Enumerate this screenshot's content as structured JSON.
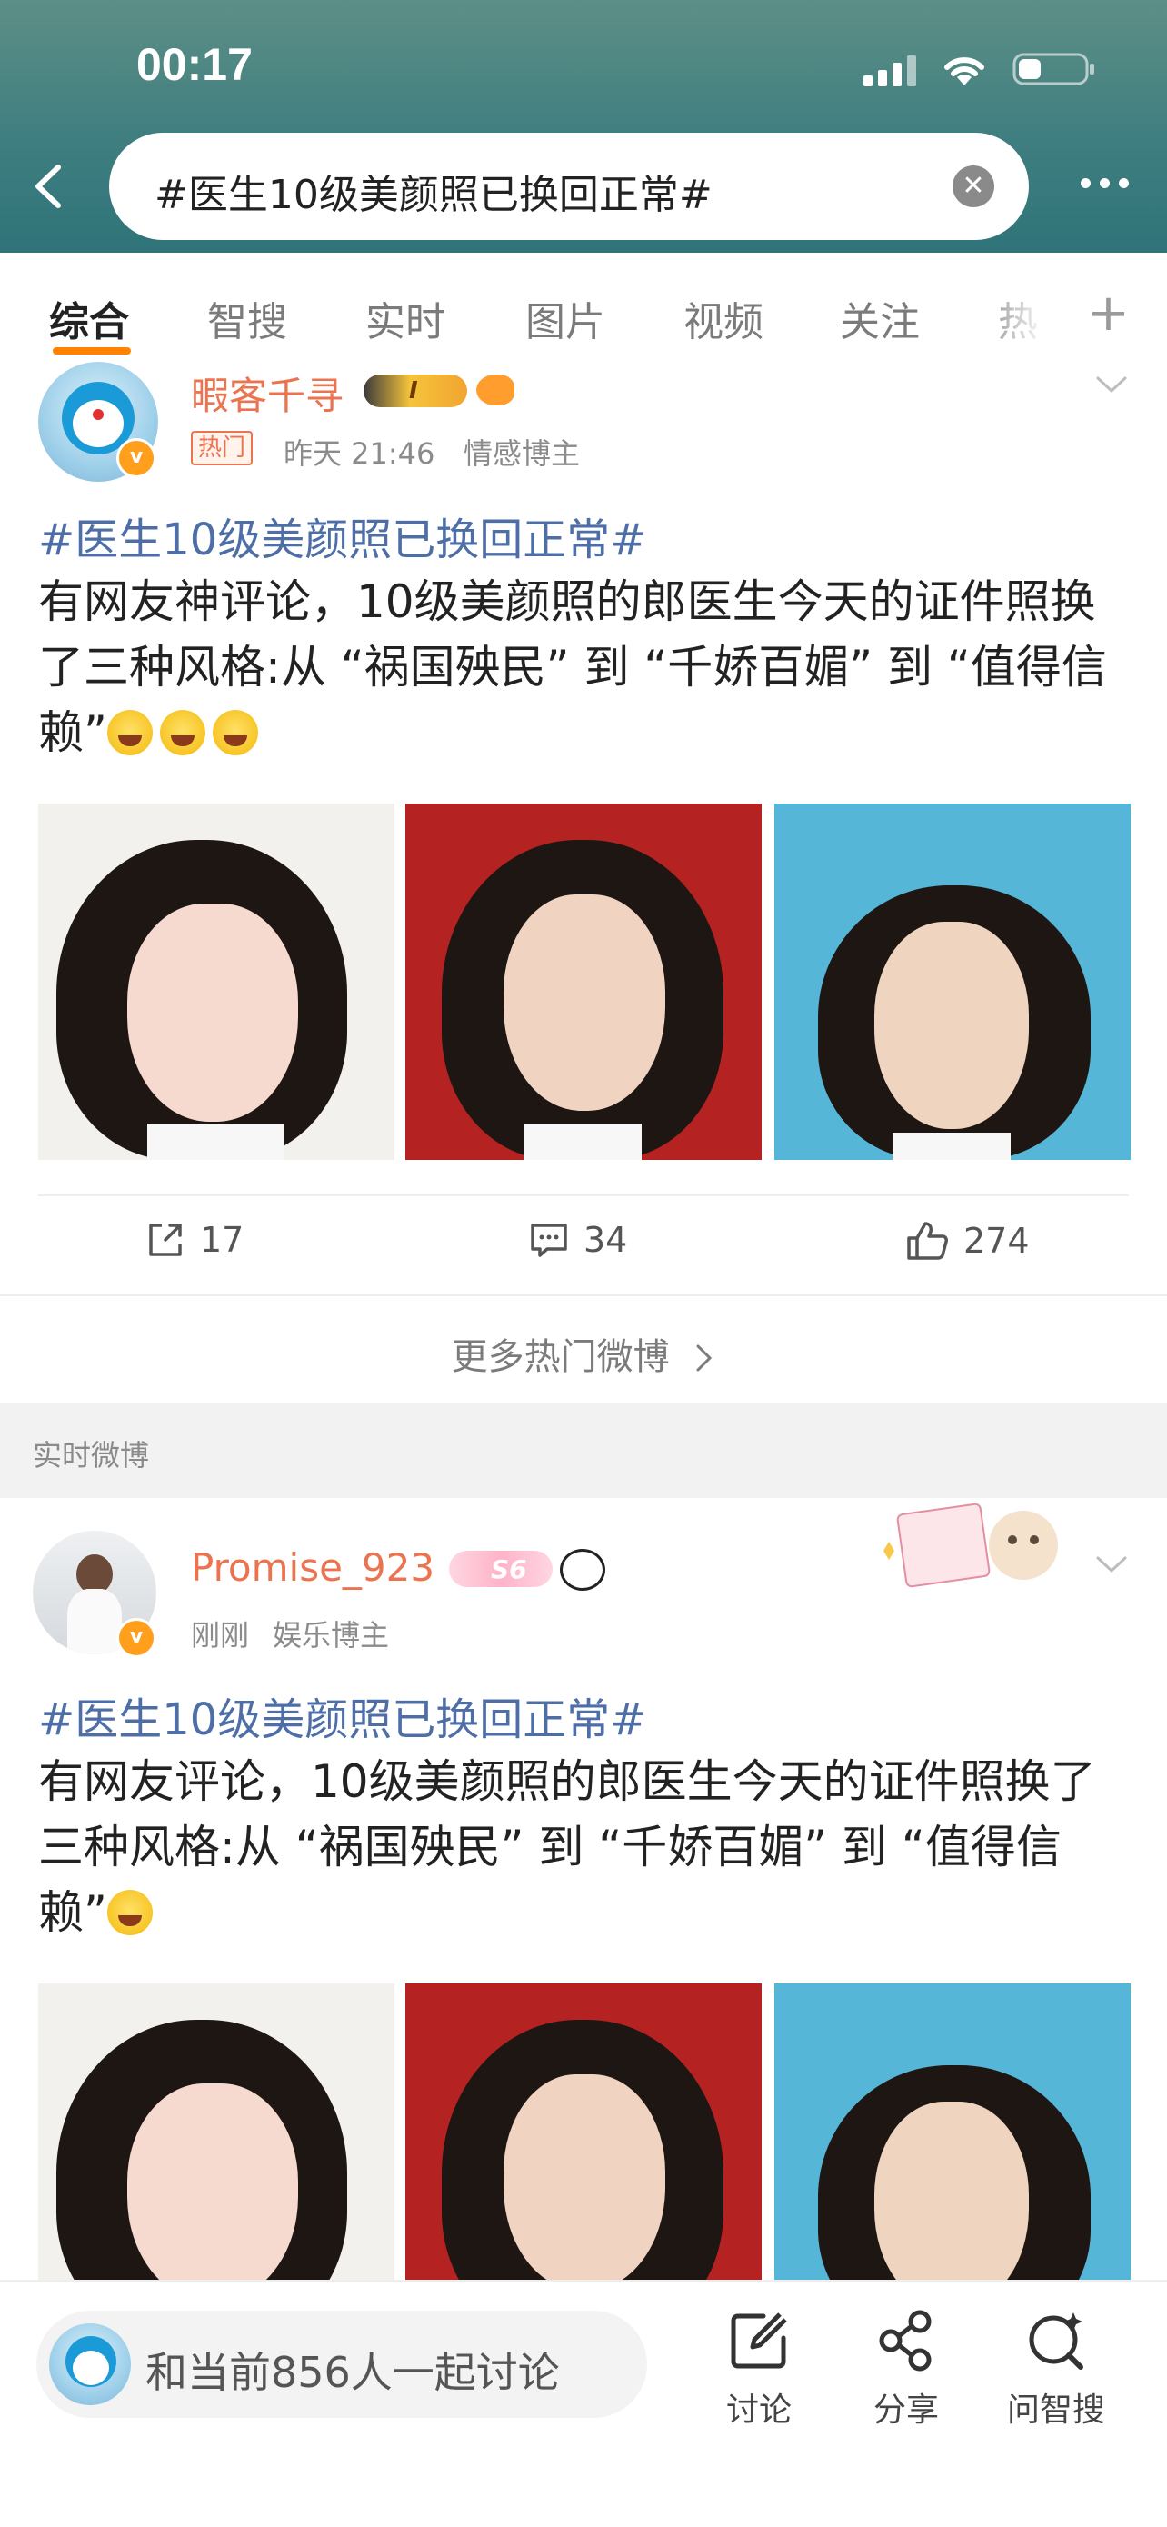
{
  "status_bar": {
    "time": "00:17"
  },
  "search": {
    "query": "#医生10级美颜照已换回正常#"
  },
  "tabs": [
    {
      "label": "综合",
      "active": true
    },
    {
      "label": "智搜"
    },
    {
      "label": "实时"
    },
    {
      "label": "图片"
    },
    {
      "label": "视频"
    },
    {
      "label": "关注"
    },
    {
      "label": "热"
    }
  ],
  "posts": [
    {
      "username": "暇客千寻",
      "level_badge": "I",
      "hot_tag": "热门",
      "time": "昨天 21:46",
      "role": "情感博主",
      "topic": "#医生10级美颜照已换回正常#",
      "text": "有网友神评论，10级美颜照的郎医生今天的证件照换了三种风格:从 “祸国殃民” 到 “千娇百媚” 到 “值得信赖”",
      "shares": "17",
      "comments": "34",
      "likes": "274"
    },
    {
      "username": "Promise_923",
      "level_badge": "S6",
      "time": "刚刚",
      "role": "娱乐博主",
      "topic": "#医生10级美颜照已换回正常#",
      "text": "有网友评论，10级美颜照的郎医生今天的证件照换了三种风格:从 “祸国殃民” 到 “千娇百媚” 到 “值得信赖”"
    }
  ],
  "more_hot": "更多热门微博",
  "section_realtime": "实时微博",
  "bottom_bar": {
    "discuss": "和当前856人一起讨论",
    "actions": [
      {
        "label": "讨论",
        "icon": "compose-icon"
      },
      {
        "label": "分享",
        "icon": "share-icon"
      },
      {
        "label": "问智搜",
        "icon": "ai-search-icon"
      }
    ]
  },
  "colors": {
    "accent_orange": "#ff8200",
    "username_orange": "#eb7350",
    "topic_blue": "#4e6ea8",
    "header_teal": "#3f7e80"
  }
}
